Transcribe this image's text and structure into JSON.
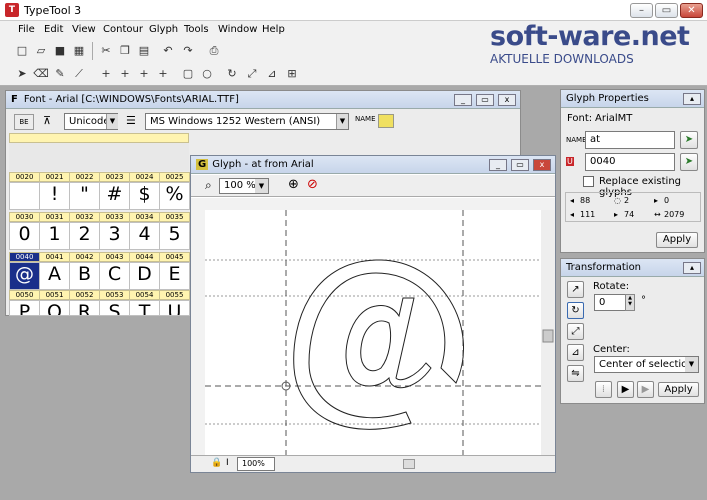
{
  "app": {
    "title": "TypeTool 3",
    "icon_text": "T"
  },
  "menu": [
    "File",
    "Edit",
    "View",
    "Contour",
    "Glyph",
    "Tools",
    "Window",
    "Help"
  ],
  "watermark": {
    "line1": "soft-ware.net",
    "line2": "AKTUELLE DOWNLOADS"
  },
  "font_window": {
    "title": "Font - Arial [C:\\WINDOWS\\Fonts\\ARIAL.TTF]",
    "encoding": "Unicode",
    "codepage": "MS Windows 1252 Western (ANSI)",
    "rows": [
      {
        "codes": [
          "0020",
          "0021",
          "0022",
          "0023",
          "0024",
          "0025"
        ],
        "chars": [
          "",
          "!",
          "\"",
          "#",
          "$",
          "%"
        ]
      },
      {
        "codes": [
          "0030",
          "0031",
          "0032",
          "0033",
          "0034",
          "0035"
        ],
        "chars": [
          "0",
          "1",
          "2",
          "3",
          "4",
          "5"
        ]
      },
      {
        "codes": [
          "0040",
          "0041",
          "0042",
          "0043",
          "0044",
          "0045"
        ],
        "chars": [
          "@",
          "A",
          "B",
          "C",
          "D",
          "E"
        ]
      },
      {
        "codes": [
          "0050",
          "0051",
          "0052",
          "0053",
          "0054",
          "0055"
        ],
        "chars": [
          "P",
          "Q",
          "R",
          "S",
          "T",
          "U"
        ]
      }
    ]
  },
  "glyph_window": {
    "title": "Glyph - at from Arial",
    "zoom": "100 %",
    "zoom_bottom": "100%",
    "ruler_top": [
      "-800",
      "-400",
      "0",
      "400",
      "800",
      "1200",
      "1600",
      "2000",
      "2400"
    ],
    "ruler_left": [
      "1800",
      "1400",
      "1000",
      "600",
      "200",
      "-200",
      "-600",
      "-1000"
    ]
  },
  "glyph_props": {
    "title": "Glyph Properties",
    "font_label": "Font:",
    "font_value": "ArialMT",
    "name_label": "NAME",
    "name_value": "at",
    "unicode_value": "0040",
    "replace_label": "Replace existing glyphs",
    "metrics": {
      "m1": "88",
      "m2": "2",
      "m3": "0",
      "m4": "111",
      "m5": "74",
      "m6": "2079"
    },
    "apply": "Apply"
  },
  "transformation": {
    "title": "Transformation",
    "rotate_label": "Rotate:",
    "rotate_value": "0",
    "degree": "°",
    "center_label": "Center:",
    "center_value": "Center of selection",
    "apply": "Apply"
  }
}
